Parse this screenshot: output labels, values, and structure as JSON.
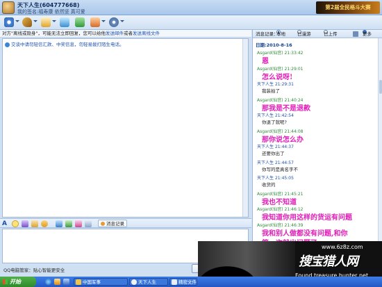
{
  "window": {
    "title": "天下人生(604777668)",
    "signature": "我的签名:福寿康 依然坚 真可爱"
  },
  "banner_ad": {
    "text": "第2届全民格斗大赛"
  },
  "colors": {
    "accent": "#1a4fb5",
    "message_pink": "#e11fb8",
    "sender_green": "#2e8b3a",
    "sender_blue": "#1c4faa",
    "taskbar": "#2458c4"
  },
  "toolbar": {
    "items": [
      {
        "icon": "video-icon"
      },
      {
        "icon": "voice-icon"
      },
      {
        "icon": "file-transfer-icon"
      },
      {
        "icon": "sms-icon"
      },
      {
        "icon": "application-icon"
      },
      {
        "icon": "group-icon"
      },
      {
        "icon": "more-settings-icon"
      }
    ]
  },
  "notice": {
    "text": "对方\"离线或隐身\"，可能无法立即回复，您可以给他",
    "link1": "发送邮件",
    "or": "或者",
    "link2": "发送离线文件"
  },
  "chat": {
    "system_line": "交谈中请勿轻信汇款、中奖信息，勿轻易拨打陌生电话。"
  },
  "input_toolbar": {
    "history_label": "消息记录"
  },
  "footer": {
    "tip": "QQ电脑管家：贴心智能更安全"
  },
  "records": {
    "header_label": "消息记录：",
    "filters": [
      "本地",
      "已漫游",
      "已上传"
    ],
    "more_label": "更多",
    "date": "日期:2010-8-16",
    "messages": [
      {
        "sender": "Asgard(仙宫)",
        "time": "21:33:42",
        "text": "恩",
        "style": "big",
        "color": "g"
      },
      {
        "sender": "Asgard(仙宫)",
        "time": "21:29:01",
        "text": "怎么说呀!",
        "style": "big",
        "color": "g"
      },
      {
        "sender": "天下人生",
        "time": "21:29:31",
        "text": "我装拍了",
        "style": "small",
        "color": "b"
      },
      {
        "sender": "Asgard(仙宫)",
        "time": "21:40:24",
        "text": "那我是不是退款",
        "style": "big",
        "color": "g"
      },
      {
        "sender": "天下人生",
        "time": "21:42:54",
        "text": "你退了就呢?",
        "style": "small",
        "color": "b"
      },
      {
        "sender": "Asgard(仙宫)",
        "time": "21:44:08",
        "text": "那你说怎么办",
        "style": "big",
        "color": "g"
      },
      {
        "sender": "天下人生",
        "time": "21:44:37",
        "text": "还要你出了",
        "style": "small",
        "color": "b"
      },
      {
        "sender": "天下人生",
        "time": "21:44:57",
        "text": "你写的是真名字不",
        "style": "small",
        "color": "b"
      },
      {
        "sender": "天下人生",
        "time": "21:45:05",
        "text": "收货的",
        "style": "small",
        "color": "b"
      },
      {
        "sender": "Asgard(仙宫)",
        "time": "21:45:21",
        "text": "我也不知道",
        "style": "big",
        "color": "g"
      },
      {
        "sender": "Asgard(仙宫)",
        "time": "21:46:12",
        "text": "我知道你用这样的货运有问题",
        "style": "big",
        "color": "g"
      },
      {
        "sender": "Asgard(仙宫)",
        "time": "21:46:39",
        "text": "我和别人做都没有问题,和你",
        "style": "big",
        "color": "g"
      },
      {
        "sender": "",
        "time": "",
        "text": "第一次就出问题了",
        "style": "big",
        "color": "g"
      }
    ]
  },
  "watermark": {
    "url": "www.6z8z.com",
    "cn": "搜宝猎人网",
    "en": "Found treasure hunter net"
  },
  "taskbar": {
    "start_label": "开始",
    "tasks": [
      "中国军事",
      "天下人生",
      "精密文件"
    ]
  }
}
